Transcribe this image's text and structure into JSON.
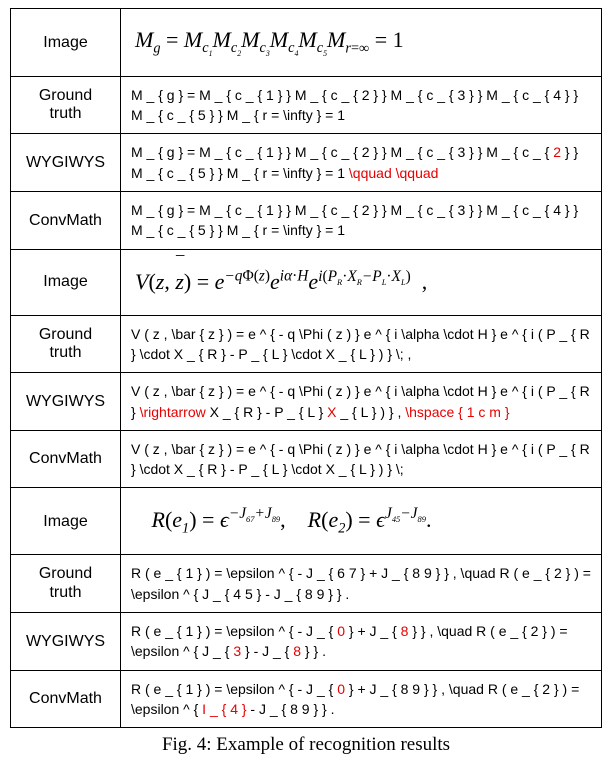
{
  "labels": {
    "image": "Image",
    "ground_truth_l1": "Ground",
    "ground_truth_l2": "truth",
    "wygiwys": "WYGIWYS",
    "convmath": "ConvMath"
  },
  "example1": {
    "gt": "M _ { g } = M _ { c _ { 1 } } M _ { c _ { 2 } } M _ { c _ { 3 } } M _ { c _ { 4 } } M _ { c _ { 5 } } M _ { r = \\infty } = 1",
    "wy_a": "M _ { g } = M _ { c _ { 1 } } M _ { c _ { 2 } } M _ { c _ { 3 } } M _ { c _ { ",
    "wy_e1": "2",
    "wy_b": " } } M _ { c _ { 5 } } M _ { r = \\infty } = 1 ",
    "wy_e2": "\\qquad \\qquad",
    "cm": "M _ { g } = M _ { c _ { 1 } } M _ { c _ { 2 } } M _ { c _ { 3 } } M _ { c _ { 4 } } M _ { c _ { 5 } } M _ { r = \\infty } = 1"
  },
  "example2": {
    "gt": "V ( z , \\bar { z } ) = e ^ { - q \\Phi ( z ) } e ^ { i \\alpha \\cdot H } e ^ { i ( P _ { R } \\cdot X _ { R } - P _ { L } \\cdot X _ { L } ) } \\; ,",
    "wy_a": "V ( z , \\bar { z } ) = e ^ { - q \\Phi ( z ) } e ^ { i \\alpha \\cdot H } e ^ { i ( P _ { R } ",
    "wy_e1": "\\rightarrow",
    "wy_b": " X _ { R } - P _ { L } ",
    "wy_e2": "X",
    "wy_c": " _ { L } ) } , ",
    "wy_e3": "\\hspace { 1 c m }",
    "cm": "V ( z , \\bar { z } ) = e ^ { - q \\Phi ( z ) } e ^ { i \\alpha \\cdot H } e ^ { i ( P _ { R } \\cdot X _ { R } - P _ { L } \\cdot X _ { L } ) } \\;"
  },
  "example3": {
    "gt": "R ( e _ { 1 } ) = \\epsilon ^ { - J _ { 6 7 } + J _ { 8 9 } } , \\quad R ( e _ { 2 } ) = \\epsilon ^ { J _ { 4 5 } - J _ { 8 9 } } .",
    "wy_a": "R ( e _ { 1 } ) = \\epsilon ^ { - J _ { ",
    "wy_e1": "0",
    "wy_b": " } + J _ { ",
    "wy_e2": "8",
    "wy_c": " } } , \\quad R ( e _ { 2 } ) = \\epsilon ^ { J _ { ",
    "wy_e3": "3",
    "wy_d": " } -     J _ { ",
    "wy_e4": "8",
    "wy_e": " } } .",
    "cm_a": "R ( e _ { 1 } ) = \\epsilon ^ { - J _ { ",
    "cm_e1": "0",
    "cm_b": " } + J _ { 8 9 } } , \\quad R ( e _ { 2 } ) = \\epsilon ^ { ",
    "cm_e2": "I _ { 4 }",
    "cm_c": " - J _ { 8 9 } } ."
  },
  "caption": "Fig. 4: Example of recognition results"
}
